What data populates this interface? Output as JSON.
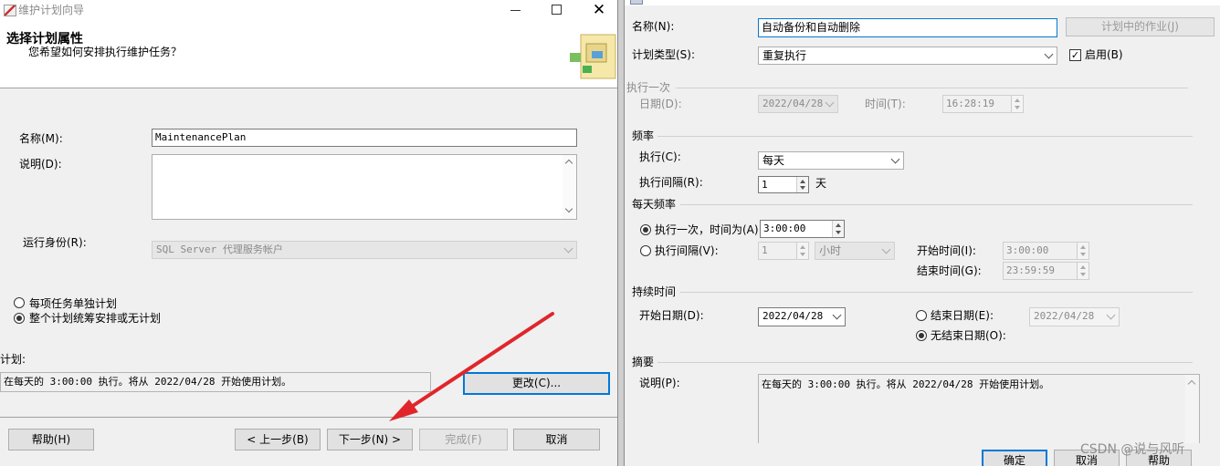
{
  "left": {
    "window_title": "维护计划向导",
    "header_title": "选择计划属性",
    "header_subtitle": "您希望如何安排执行维护任务？",
    "name_label": "名称(M):",
    "name_value": "MaintenancePlan",
    "desc_label": "说明(D):",
    "run_as_label": "运行身份(R):",
    "run_as_value": "SQL Server 代理服务帐户",
    "radio_separate": "每项任务单独计划",
    "radio_single": "整个计划统筹安排或无计划",
    "schedule_label": "计划:",
    "schedule_value": "在每天的 3:00:00 执行。将从 2022/04/28 开始使用计划。",
    "change_button": "更改(C)...",
    "help_button": "帮助(H)",
    "back_button": "< 上一步(B)",
    "next_button": "下一步(N) >",
    "finish_button": "完成(F)",
    "cancel_button": "取消"
  },
  "right": {
    "name_label": "名称(N):",
    "name_value": "自动备份和自动删除",
    "jobs_button": "计划中的作业(J)",
    "type_label": "计划类型(S):",
    "type_value": "重复执行",
    "enabled_label": "启用(B)",
    "once_group": "执行一次",
    "once_date_label": "日期(D):",
    "once_date_value": "2022/04/28",
    "once_time_label": "时间(T):",
    "once_time_value": "16:28:19",
    "freq_group": "频率",
    "occurs_label": "执行(C):",
    "occurs_value": "每天",
    "recurs_label": "执行间隔(R):",
    "recurs_value": "1",
    "recurs_unit": "天",
    "daily_group": "每天频率",
    "daily_once_label": "执行一次，时间为(A):",
    "daily_once_value": "3:00:00",
    "daily_every_label": "执行间隔(V):",
    "daily_every_value": "1",
    "daily_every_unit": "小时",
    "start_time_label": "开始时间(I):",
    "start_time_value": "3:00:00",
    "end_time_label": "结束时间(G):",
    "end_time_value": "23:59:59",
    "duration_group": "持续时间",
    "start_date_label": "开始日期(D):",
    "start_date_value": "2022/04/28",
    "end_date_label": "结束日期(E):",
    "end_date_value": "2022/04/28",
    "no_end_label": "无结束日期(O):",
    "summary_group": "摘要",
    "summary_label": "说明(P):",
    "summary_value": "在每天的 3:00:00 执行。将从 2022/04/28 开始使用计划。",
    "ok_button": "确定",
    "cancel_button": "取消",
    "help_button": "帮助"
  },
  "watermark": "CSDN @说与风听",
  "colors": {
    "focus": "#0078d7",
    "arrow": "#e0262b"
  }
}
